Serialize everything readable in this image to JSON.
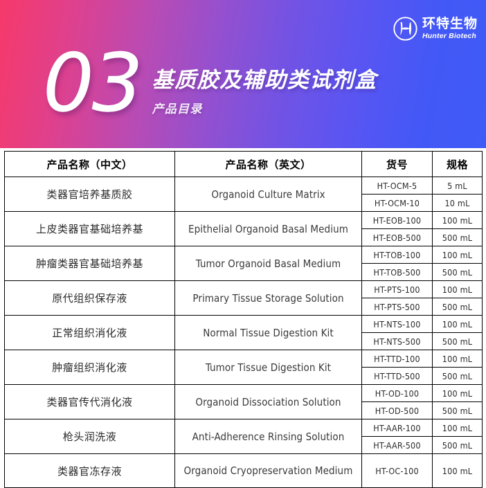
{
  "banner": {
    "number": "03",
    "title": "基质胶及辅助类试剂盒",
    "subtitle": "产品目录",
    "gradient_from": "#f6396a",
    "gradient_mid": "#9450cf",
    "gradient_to": "#3f5bf7",
    "logo": {
      "icon": "hunter-biotech-swirl-logo",
      "name_cn": "环特生物",
      "name_en": "Hunter Biotech"
    }
  },
  "table": {
    "headers": {
      "name_cn": "产品名称（中文）",
      "name_en": "产品名称（英文）",
      "catalog_no": "货号",
      "spec": "规格"
    },
    "rows": [
      {
        "name_cn": "类器官培养基质胶",
        "name_en": "Organoid Culture Matrix",
        "variants": [
          {
            "catalog_no": "HT-OCM-5",
            "spec": "5 mL"
          },
          {
            "catalog_no": "HT-OCM-10",
            "spec": "10 mL"
          }
        ]
      },
      {
        "name_cn": "上皮类器官基础培养基",
        "name_en": "Epithelial Organoid Basal Medium",
        "variants": [
          {
            "catalog_no": "HT-EOB-100",
            "spec": "100 mL"
          },
          {
            "catalog_no": "HT-EOB-500",
            "spec": "500 mL"
          }
        ]
      },
      {
        "name_cn": "肿瘤类器官基础培养基",
        "name_en": "Tumor Organoid Basal Medium",
        "variants": [
          {
            "catalog_no": "HT-TOB-100",
            "spec": "100 mL"
          },
          {
            "catalog_no": "HT-TOB-500",
            "spec": "500 mL"
          }
        ]
      },
      {
        "name_cn": "原代组织保存液",
        "name_en": "Primary Tissue Storage Solution",
        "variants": [
          {
            "catalog_no": "HT-PTS-100",
            "spec": "100 mL"
          },
          {
            "catalog_no": "HT-PTS-500",
            "spec": "500 mL"
          }
        ]
      },
      {
        "name_cn": "正常组织消化液",
        "name_en": "Normal Tissue Digestion Kit",
        "variants": [
          {
            "catalog_no": "HT-NTS-100",
            "spec": "100 mL"
          },
          {
            "catalog_no": "HT-NTS-500",
            "spec": "500 mL"
          }
        ]
      },
      {
        "name_cn": "肿瘤组织消化液",
        "name_en": "Tumor Tissue Digestion Kit",
        "variants": [
          {
            "catalog_no": "HT-TTD-100",
            "spec": "100 mL"
          },
          {
            "catalog_no": "HT-TTD-500",
            "spec": "500 mL"
          }
        ]
      },
      {
        "name_cn": "类器官传代消化液",
        "name_en": "Organoid Dissociation Solution",
        "variants": [
          {
            "catalog_no": "HT-OD-100",
            "spec": "100 mL"
          },
          {
            "catalog_no": "HT-OD-500",
            "spec": "500 mL"
          }
        ]
      },
      {
        "name_cn": "枪头润洗液",
        "name_en": "Anti-Adherence Rinsing Solution",
        "variants": [
          {
            "catalog_no": "HT-AAR-100",
            "spec": "100 mL"
          },
          {
            "catalog_no": "HT-AAR-500",
            "spec": "500 mL"
          }
        ]
      },
      {
        "name_cn": "类器官冻存液",
        "name_en": "Organoid Cryopreservation Medium",
        "variants": [
          {
            "catalog_no": "HT-OC-100",
            "spec": "100 mL"
          }
        ]
      }
    ]
  }
}
